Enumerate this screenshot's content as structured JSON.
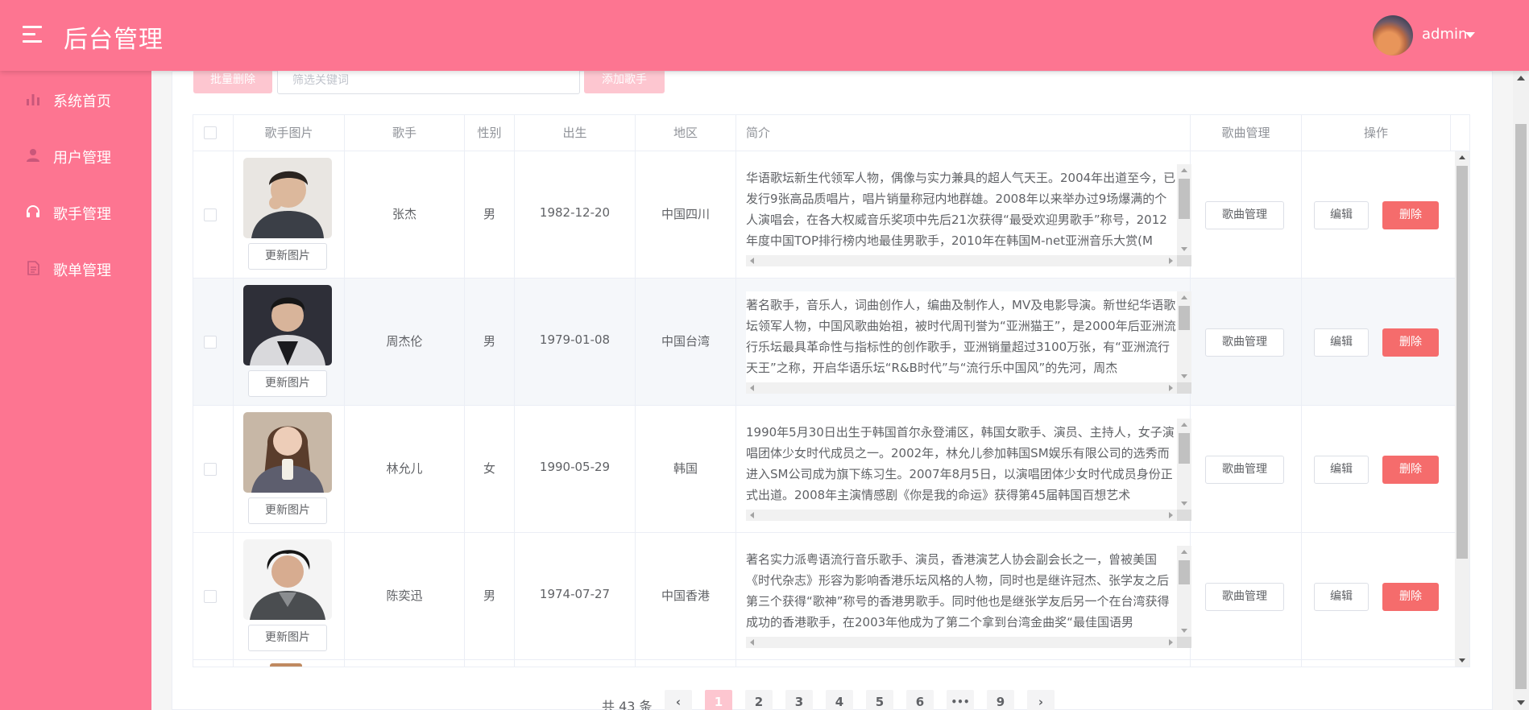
{
  "header": {
    "title": "后台管理",
    "username": "admin"
  },
  "colors": {
    "brand_pink": "#fd7591",
    "light_pink": "#fdc6d0",
    "danger": "#f56c6c"
  },
  "sidebar": {
    "items": [
      {
        "label": "系统首页",
        "icon": "bar-chart-icon"
      },
      {
        "label": "用户管理",
        "icon": "user-icon"
      },
      {
        "label": "歌手管理",
        "icon": "headphones-icon"
      },
      {
        "label": "歌单管理",
        "icon": "document-icon"
      }
    ]
  },
  "toolbar": {
    "batch_delete": "批量删除",
    "filter_placeholder": "筛选关键词",
    "add_singer": "添加歌手"
  },
  "table": {
    "columns": [
      "歌手图片",
      "歌手",
      "性别",
      "出生",
      "地区",
      "简介",
      "歌曲管理",
      "操作"
    ],
    "update_pic_label": "更新图片",
    "song_manage_label": "歌曲管理",
    "edit_label": "编辑",
    "delete_label": "删除",
    "rows": [
      {
        "name": "张杰",
        "sex": "男",
        "birth": "1982-12-20",
        "location": "中国四川",
        "intro": "华语歌坛新生代领军人物，偶像与实力兼具的超人气天王。2004年出道至今，已发行9张高品质唱片，唱片销量称冠内地群雄。2008年以来举办过9场爆满的个人演唱会，在各大权威音乐奖项中先后21次获得“最受欢迎男歌手”称号，2012年度中国TOP排行榜内地最佳男歌手，2010年在韩国M-net亚洲音乐大赏(M"
      },
      {
        "name": "周杰伦",
        "sex": "男",
        "birth": "1979-01-08",
        "location": "中国台湾",
        "intro": "著名歌手，音乐人，词曲创作人，编曲及制作人，MV及电影导演。新世纪华语歌坛领军人物，中国风歌曲始祖，被时代周刊誉为“亚洲猫王”，是2000年后亚洲流行乐坛最具革命性与指标性的创作歌手，亚洲销量超过3100万张，有“亚洲流行天王”之称，开启华语乐坛“R&B时代”与“流行乐中国风”的先河，周杰"
      },
      {
        "name": "林允儿",
        "sex": "女",
        "birth": "1990-05-29",
        "location": "韩国",
        "intro": "1990年5月30日出生于韩国首尔永登浦区，韩国女歌手、演员、主持人，女子演唱团体少女时代成员之一。2002年，林允儿参加韩国SM娱乐有限公司的选秀而进入SM公司成为旗下练习生。2007年8月5日，以演唱团体少女时代成员身份正式出道。2008年主演情感剧《你是我的命运》获得第45届韩国百想艺术"
      },
      {
        "name": "陈奕迅",
        "sex": "男",
        "birth": "1974-07-27",
        "location": "中国香港",
        "intro": "著名实力派粤语流行音乐歌手、演员，香港演艺人协会副会长之一，曾被美国《时代杂志》形容为影响香港乐坛风格的人物，同时也是继许冠杰、张学友之后第三个获得“歌神”称号的香港男歌手。同时他也是继张学友后另一个在台湾获得成功的香港歌手，在2003年他成为了第二个拿到台湾金曲奖“最佳国语男"
      }
    ]
  },
  "pagination": {
    "total_text": "共 43 条",
    "prev": "‹",
    "next": "›",
    "pages": [
      "1",
      "2",
      "3",
      "4",
      "5",
      "6",
      "•••",
      "9"
    ],
    "current": "1"
  }
}
